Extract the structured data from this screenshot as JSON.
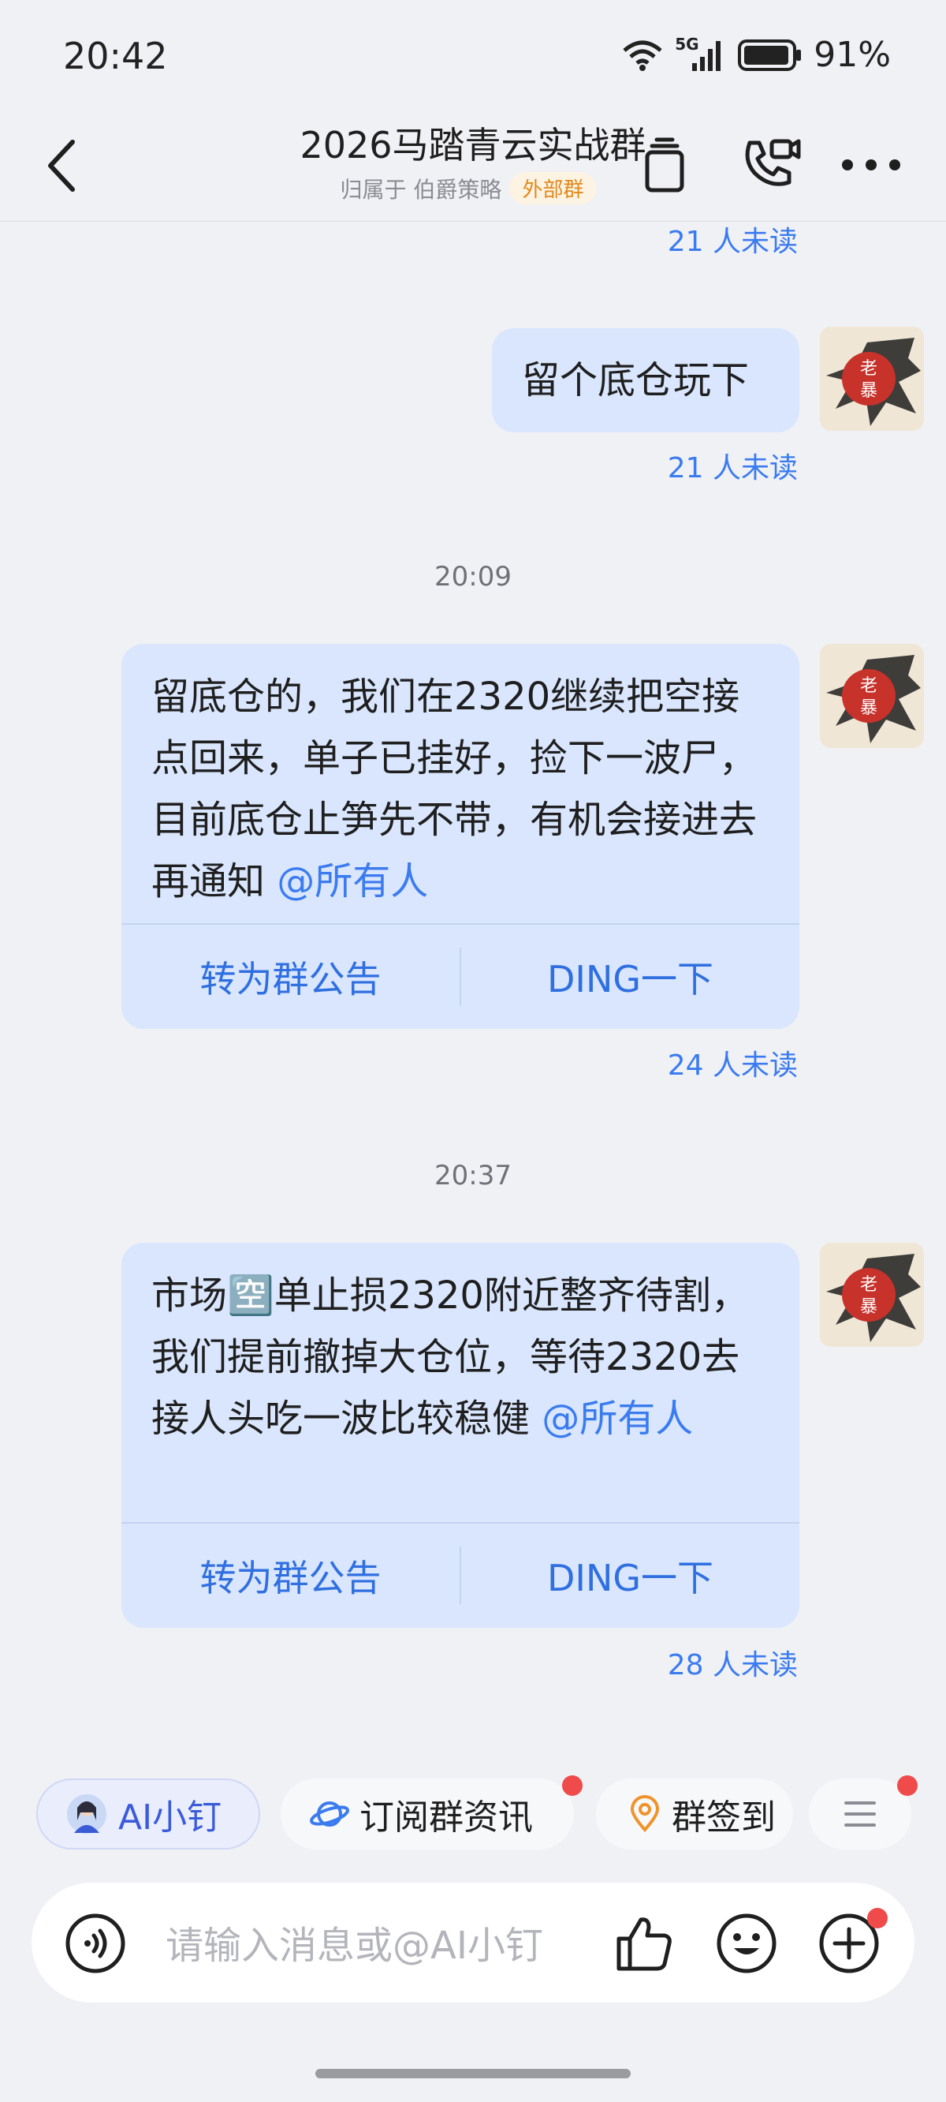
{
  "status_bar": {
    "time": "20:42",
    "network": "5G",
    "battery": "91%"
  },
  "header": {
    "title": "2026马踏青云实战群",
    "owner": "归属于 伯爵策略",
    "tag": "外部群"
  },
  "messages": [
    {
      "unread": "21 人未读"
    },
    {
      "text": "留个底仓玩下",
      "unread": "21 人未读"
    },
    {
      "time": "20:09"
    },
    {
      "text": "留底仓的，我们在2320继续把空接点回来，单子已挂好，捡下一波尸，目前底仓止笋先不带，有机会接进去再通知 ",
      "mention": "@所有人",
      "actions": [
        "转为群公告",
        "DING一下"
      ],
      "unread": "24 人未读"
    },
    {
      "time": "20:37"
    },
    {
      "text": "市场🈳单止损2320附近整齐待割，我们提前撤掉大仓位，等待2320去接人头吃一波比较稳健 ",
      "mention": "@所有人",
      "actions": [
        "转为群公告",
        "DING一下"
      ],
      "unread": "28 人未读"
    }
  ],
  "avatar_text": "老暴",
  "quick_actions": [
    "AI小钉",
    "订阅群资讯",
    "群签到"
  ],
  "input": {
    "placeholder": "请输入消息或@AI小钉"
  },
  "colors": {
    "bubble": "#d9e6fd",
    "accent": "#3b7bf0",
    "background": "#f0f1f5",
    "badge": "#f04b4b"
  }
}
